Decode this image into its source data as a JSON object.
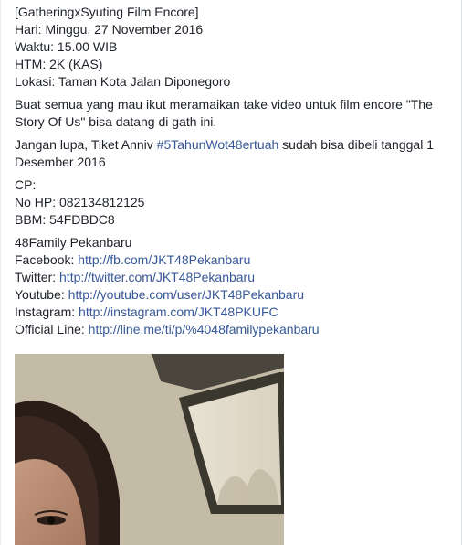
{
  "post": {
    "event_lines": [
      "[GatheringxSyuting Film Encore]",
      "Hari: Minggu, 27 November 2016",
      "Waktu: 15.00 WIB",
      "HTM: 2K (KAS)",
      "Lokasi: Taman Kota Jalan Diponegoro"
    ],
    "invite": "Buat semua yang mau ikut meramaikan take video untuk film encore \"The Story Of Us\" bisa datang di gath ini.",
    "reminder_before": "Jangan lupa, Tiket Anniv ",
    "reminder_hashtag": "#5TahunWot48ertuah",
    "reminder_after": " sudah bisa dibeli tanggal 1 Desember 2016",
    "contact_lines": [
      "CP:",
      "No HP: 082134812125",
      "BBM: 54FDBDC8"
    ],
    "group_name": "48Family Pekanbaru",
    "links": [
      {
        "label": "Facebook: ",
        "url": "http://fb.com/JKT48Pekanbaru"
      },
      {
        "label": "Twitter: ",
        "url": "http://twitter.com/JKT48Pekanbaru"
      },
      {
        "label": "Youtube: ",
        "url": "http://youtube.com/user/JKT48Pekanbaru"
      },
      {
        "label": "Instagram: ",
        "url": "http://instagram.com/JKT48PKUFC"
      },
      {
        "label": "Official Line: ",
        "url": "http://line.me/ti/p/%4048familypekanbaru"
      }
    ]
  },
  "colors": {
    "text": "#1d2129",
    "link": "#365899",
    "background": "#ffffff"
  }
}
